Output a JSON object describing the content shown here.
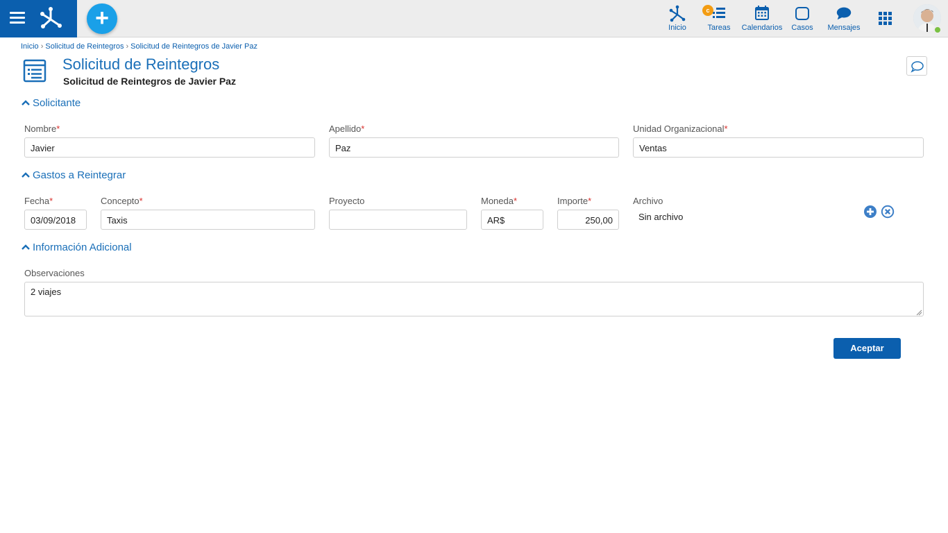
{
  "topbar": {
    "nav": [
      {
        "label": "Inicio",
        "icon": "home-network-icon"
      },
      {
        "label": "Tareas",
        "icon": "tasks-icon",
        "badge": "c"
      },
      {
        "label": "Calendarios",
        "icon": "calendar-icon"
      },
      {
        "label": "Casos",
        "icon": "cases-icon"
      },
      {
        "label": "Mensajes",
        "icon": "messages-icon"
      }
    ],
    "add_label": "+",
    "colors": {
      "brand": "#0b5fae",
      "add": "#1aa0e8",
      "online": "#7ac143",
      "badge": "#f39c12"
    }
  },
  "breadcrumb": [
    "Inicio",
    "Solicitud de Reintegros",
    "Solicitud de Reintegros de Javier Paz"
  ],
  "page": {
    "title": "Solicitud de Reintegros",
    "subtitle": "Solicitud de Reintegros de Javier Paz"
  },
  "sections": {
    "solicitante": {
      "title": "Solicitante",
      "fields": {
        "nombre": {
          "label": "Nombre",
          "value": "Javier",
          "required": "*"
        },
        "apellido": {
          "label": "Apellido",
          "value": "Paz",
          "required": "*"
        },
        "unidad": {
          "label": "Unidad Organizacional",
          "value": "Ventas",
          "required": "*"
        }
      }
    },
    "gastos": {
      "title": "Gastos a Reintegrar",
      "columns": {
        "fecha": {
          "label": "Fecha",
          "required": "*"
        },
        "concepto": {
          "label": "Concepto",
          "required": "*"
        },
        "proyecto": {
          "label": "Proyecto"
        },
        "moneda": {
          "label": "Moneda",
          "required": "*"
        },
        "importe": {
          "label": "Importe",
          "required": "*"
        },
        "archivo": {
          "label": "Archivo"
        }
      },
      "row": {
        "fecha": "03/09/2018",
        "concepto": "Taxis",
        "proyecto": "",
        "moneda": "AR$",
        "importe": "250,00",
        "archivo": "Sin archivo"
      }
    },
    "adicional": {
      "title": "Información Adicional",
      "observaciones": {
        "label": "Observaciones",
        "value": "2 viajes"
      }
    }
  },
  "actions": {
    "accept_label": "Aceptar"
  }
}
